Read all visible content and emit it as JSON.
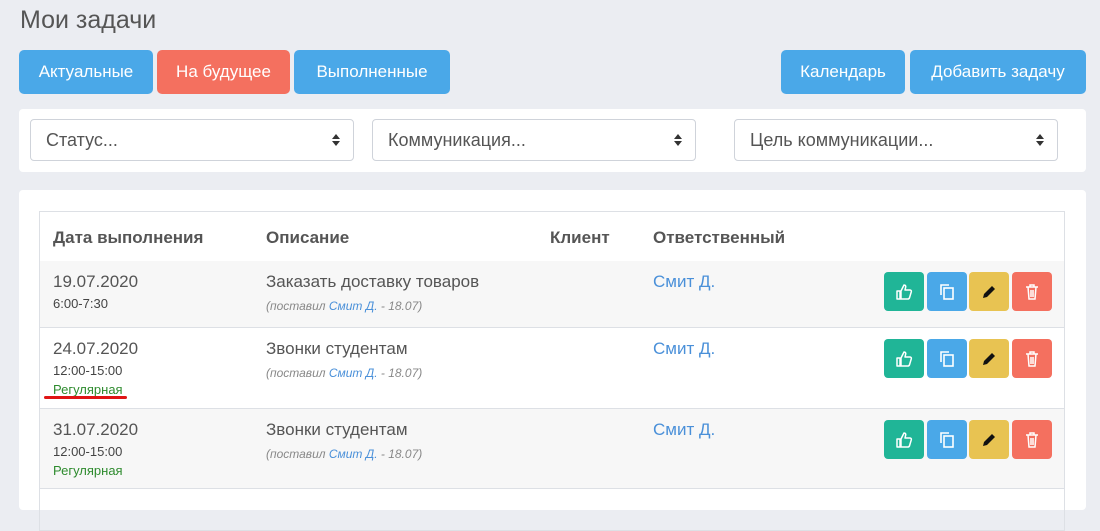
{
  "page": {
    "title": "Мои задачи"
  },
  "tabs": [
    {
      "label": "Актуальные"
    },
    {
      "label": "На будущее"
    },
    {
      "label": "Выполненные"
    }
  ],
  "actions": {
    "calendar": "Календарь",
    "add_task": "Добавить задачу"
  },
  "filters": [
    {
      "placeholder": "Статус..."
    },
    {
      "placeholder": "Коммуникация..."
    },
    {
      "placeholder": "Цель коммуникации..."
    }
  ],
  "table": {
    "headers": [
      "Дата выполнения",
      "Описание",
      "Клиент",
      "Ответственный"
    ],
    "rows": [
      {
        "date": "19.07.2020",
        "time": "6:00-7:30",
        "regular": "",
        "desc": "Заказать доставку товаров",
        "meta_prefix": "(поставил ",
        "meta_user": "Смит Д.",
        "meta_suffix": " - 18.07)",
        "client": "",
        "responsible": "Смит Д."
      },
      {
        "date": "24.07.2020",
        "time": "12:00-15:00",
        "regular": "Регулярная",
        "desc": "Звонки студентам",
        "meta_prefix": "(поставил ",
        "meta_user": "Смит Д.",
        "meta_suffix": " - 18.07)",
        "client": "",
        "responsible": "Смит Д."
      },
      {
        "date": "31.07.2020",
        "time": "12:00-15:00",
        "regular": "Регулярная",
        "desc": "Звонки студентам",
        "meta_prefix": "(поставил ",
        "meta_user": "Смит Д.",
        "meta_suffix": " - 18.07)",
        "client": "",
        "responsible": "Смит Д."
      }
    ]
  },
  "icons": {
    "complete": "thumbs-up-icon",
    "copy": "copy-icon",
    "edit": "pencil-icon",
    "delete": "trash-icon",
    "select": "sort-caret-icon"
  },
  "colors": {
    "primary": "#4aa8e8",
    "active_tab": "#f4705f",
    "complete": "#20b597",
    "edit": "#e8c352",
    "delete": "#f4705f",
    "link": "#4a90d9",
    "regular": "#2e8b2e",
    "annotation": "#e01515"
  }
}
